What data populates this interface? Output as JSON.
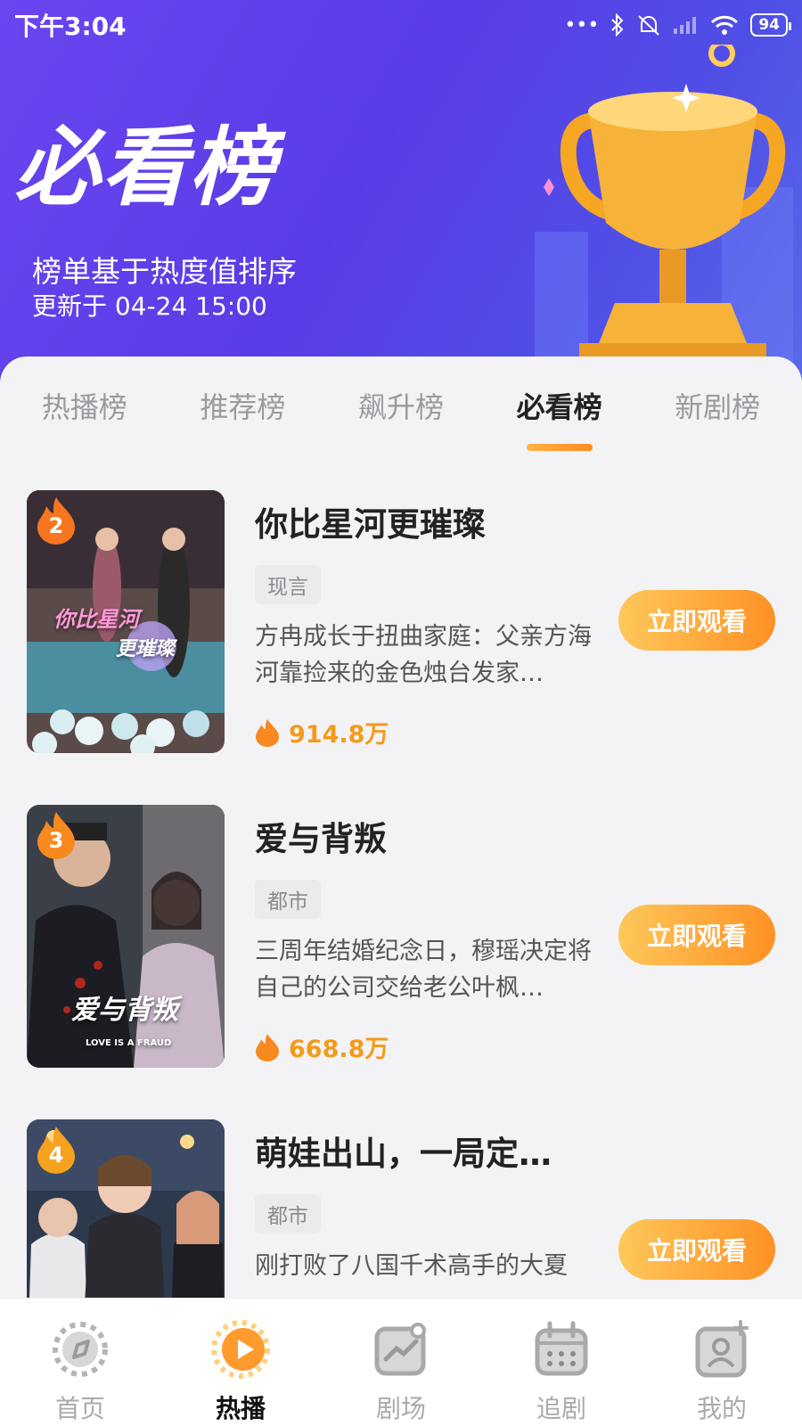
{
  "status_bar": {
    "time": "下午3:04",
    "battery": "94"
  },
  "header": {
    "title": "必看榜",
    "subtitle": "榜单基于热度值排序",
    "update_text": "更新于 04-24 15:00"
  },
  "tabs": [
    {
      "label": "热播榜",
      "active": false
    },
    {
      "label": "推荐榜",
      "active": false
    },
    {
      "label": "飙升榜",
      "active": false
    },
    {
      "label": "必看榜",
      "active": true
    },
    {
      "label": "新剧榜",
      "active": false
    }
  ],
  "items": [
    {
      "rank": "2",
      "title": "你比星河更璀璨",
      "tag": "现言",
      "desc": "方冉成长于扭曲家庭：父亲方海河靠捡来的金色烛台发家…",
      "heat": "914.8万",
      "button": "立即观看",
      "cover_text_1": "你比星河",
      "cover_text_2": "更璀璨"
    },
    {
      "rank": "3",
      "title": "爱与背叛",
      "tag": "都市",
      "desc": "三周年结婚纪念日，穆瑶决定将自己的公司交给老公叶枫…",
      "heat": "668.8万",
      "button": "立即观看",
      "cover_text_1": "爱与背叛",
      "cover_text_2": "LOVE IS A FRAUD"
    },
    {
      "rank": "4",
      "title": "萌娃出山，一局定…",
      "tag": "都市",
      "desc": "刚打败了八国千术高手的大夏",
      "heat": "",
      "button": "立即观看",
      "cover_text_1": "",
      "cover_text_2": ""
    }
  ],
  "bottom_nav": [
    {
      "label": "首页",
      "icon": "compass-icon",
      "active": false
    },
    {
      "label": "热播",
      "icon": "play-circle-icon",
      "active": true
    },
    {
      "label": "剧场",
      "icon": "chart-frame-icon",
      "active": false
    },
    {
      "label": "追剧",
      "icon": "calendar-icon",
      "active": false
    },
    {
      "label": "我的",
      "icon": "profile-icon",
      "active": false
    }
  ],
  "colors": {
    "header_purple": "#5a3ce6",
    "accent_orange": "#ff9124",
    "heat_orange": "#f49a1a"
  }
}
